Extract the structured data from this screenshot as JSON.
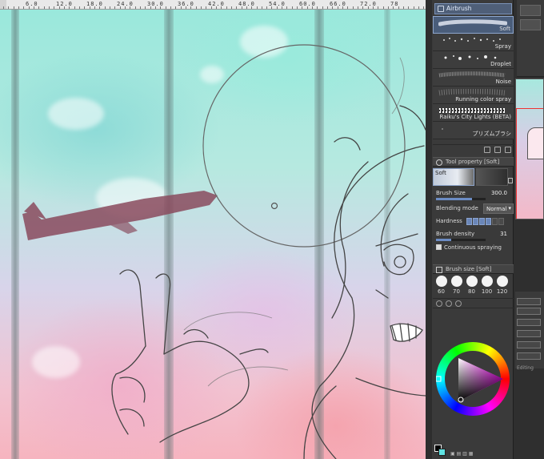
{
  "ruler": {
    "labels": [
      "6.0",
      "12.0",
      "18.0",
      "24.0",
      "30.0",
      "36.0",
      "42.0",
      "48.0",
      "54.0",
      "60.0",
      "66.0",
      "72.0",
      "78"
    ]
  },
  "sub_tool": {
    "group_label": "Airbrush",
    "brushes": [
      {
        "name": "Soft",
        "active": true
      },
      {
        "name": "Spray",
        "active": false
      },
      {
        "name": "Droplet",
        "active": false
      },
      {
        "name": "Noise",
        "active": false
      },
      {
        "name": "Running color spray",
        "active": false
      },
      {
        "name": "Raiku's City Lights (BETA)",
        "active": false
      },
      {
        "name": "プリズムブラシ",
        "active": false
      }
    ]
  },
  "tool_property": {
    "header": "Tool property [Soft]",
    "preview_label": "Soft",
    "brush_size_label": "Brush Size",
    "brush_size_value": "300.0",
    "brush_size_fraction": 0.72,
    "blending_label": "Blending mode",
    "blending_value": "Normal",
    "hardness_label": "Hardness",
    "hardness_level": 4,
    "hardness_steps": 6,
    "density_label": "Brush density",
    "density_value": "31",
    "density_fraction": 0.31,
    "continuous_label": "Continuous spraying",
    "continuous_checked": true
  },
  "brush_size_panel": {
    "header": "Brush size [Soft]",
    "sizes": [
      "60",
      "70",
      "80",
      "100",
      "120"
    ]
  },
  "color": {
    "main": "#000000",
    "sub": "#5fe3e3",
    "hue_selected": "#ff00ff"
  },
  "layer_panel": {
    "status_text": "Editing"
  }
}
